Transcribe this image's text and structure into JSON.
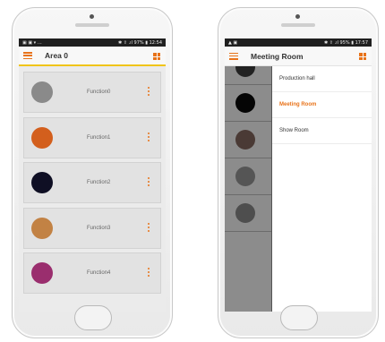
{
  "left_phone": {
    "status": {
      "left": "▣ ▣ ▾ …",
      "right": "✱ ⇪ .ıl 97% ▮ 12:54"
    },
    "title": "Area 0",
    "cards": [
      {
        "label": "Function0",
        "color": "#8a8a8a"
      },
      {
        "label": "Function1",
        "color": "#d35f1d"
      },
      {
        "label": "Function2",
        "color": "#0f0f24"
      },
      {
        "label": "Function3",
        "color": "#c28244"
      },
      {
        "label": "Function4",
        "color": "#9a2e6e"
      }
    ],
    "page_count": 5,
    "active_page": 0
  },
  "right_phone": {
    "status": {
      "left": "▲ ▣",
      "right": "✱ ⇪ .ıl 95% ▮ 17:57"
    },
    "title": "Meeting Room",
    "rooms": [
      {
        "label": "Production hall",
        "active": false
      },
      {
        "label": "Meeting Room",
        "active": true
      },
      {
        "label": "Show Room",
        "active": false
      }
    ],
    "strip_colors": [
      "#222222",
      "#050505",
      "#4a3a35",
      "#555555",
      "#4e4e4e"
    ]
  },
  "colors": {
    "accent": "#e8731a",
    "underline": "#f0c419"
  }
}
